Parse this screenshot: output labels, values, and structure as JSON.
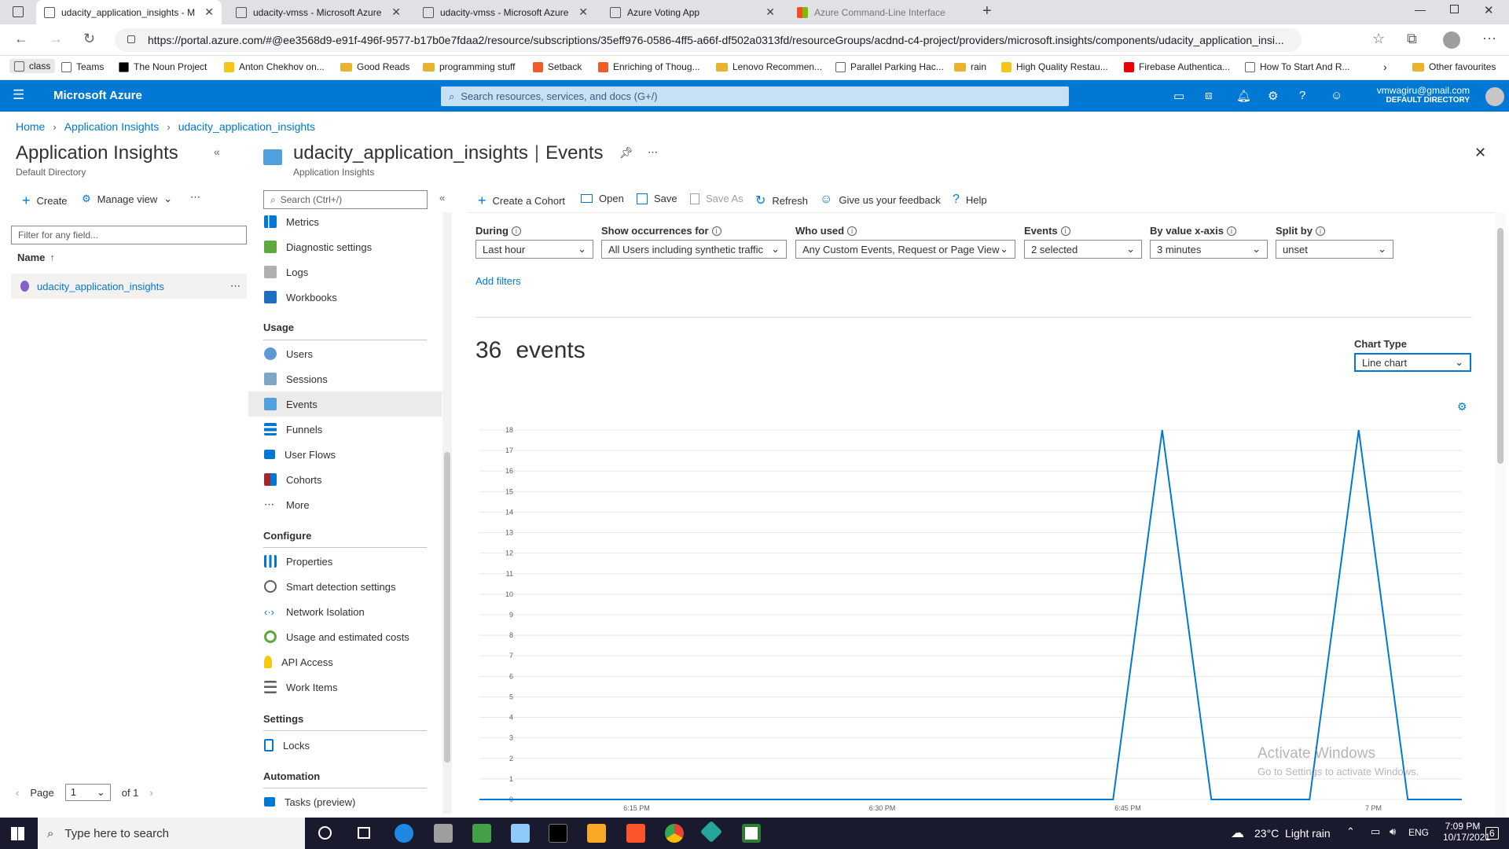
{
  "browser": {
    "tabs": [
      {
        "label": "udacity_application_insights - M",
        "active": true
      },
      {
        "label": "udacity-vmss - Microsoft Azure"
      },
      {
        "label": "udacity-vmss - Microsoft Azure"
      },
      {
        "label": "Azure Voting App"
      },
      {
        "label": "Azure Command-Line Interface"
      }
    ],
    "url": "https://portal.azure.com/#@ee3568d9-e91f-496f-9577-b17b0e7fdaa2/resource/subscriptions/35eff976-0586-4ff5-a66f-df502a0313fd/resourceGroups/acdnd-c4-project/providers/microsoft.insights/components/udacity_application_insi...",
    "bookmarks": [
      "class",
      "Teams",
      "The Noun Project",
      "Anton Chekhov on...",
      "Good Reads",
      "programming stuff",
      "Setback",
      "Enriching of Thoug...",
      "Lenovo Recommen...",
      "Parallel Parking Hac...",
      "rain",
      "High Quality Restau...",
      "Firebase Authentica...",
      "How To Start And R..."
    ],
    "other_favourites": "Other favourites"
  },
  "azure": {
    "brand": "Microsoft Azure",
    "search_placeholder": "Search resources, services, and docs (G+/)",
    "user_email": "vmwagiru@gmail.com",
    "user_directory": "DEFAULT DIRECTORY"
  },
  "breadcrumb": [
    "Home",
    "Application Insights",
    "udacity_application_insights"
  ],
  "left_blade": {
    "title": "Application Insights",
    "subtitle": "Default Directory",
    "create": "Create",
    "manage_view": "Manage view",
    "filter_placeholder": "Filter for any field...",
    "name_col": "Name",
    "item": "udacity_application_insights",
    "page_label": "Page",
    "page_value": "1",
    "page_of": "of 1"
  },
  "resource": {
    "title": "udacity_application_insights",
    "page": "Events",
    "subtitle": "Application Insights",
    "search_placeholder": "Search (Ctrl+/)"
  },
  "menu": {
    "top": [
      {
        "label": "Metrics",
        "icon": "metrics-icon"
      },
      {
        "label": "Diagnostic settings",
        "icon": "diagnostic-icon"
      },
      {
        "label": "Logs",
        "icon": "logs-icon"
      },
      {
        "label": "Workbooks",
        "icon": "workbooks-icon"
      }
    ],
    "usage_header": "Usage",
    "usage": [
      {
        "label": "Users"
      },
      {
        "label": "Sessions"
      },
      {
        "label": "Events",
        "selected": true
      },
      {
        "label": "Funnels"
      },
      {
        "label": "User Flows"
      },
      {
        "label": "Cohorts"
      },
      {
        "label": "More"
      }
    ],
    "configure_header": "Configure",
    "configure": [
      {
        "label": "Properties"
      },
      {
        "label": "Smart detection settings"
      },
      {
        "label": "Network Isolation"
      },
      {
        "label": "Usage and estimated costs"
      },
      {
        "label": "API Access"
      },
      {
        "label": "Work Items"
      }
    ],
    "settings_header": "Settings",
    "settings": [
      {
        "label": "Locks"
      }
    ],
    "automation_header": "Automation",
    "automation": [
      {
        "label": "Tasks (preview)"
      }
    ]
  },
  "toolbar": {
    "create_cohort": "Create a Cohort",
    "open": "Open",
    "save": "Save",
    "save_as": "Save As",
    "refresh": "Refresh",
    "feedback": "Give us your feedback",
    "help": "Help"
  },
  "filters": {
    "during": {
      "label": "During",
      "value": "Last hour"
    },
    "show_occurrences": {
      "label": "Show occurrences for",
      "value": "All Users including synthetic traffic"
    },
    "who_used": {
      "label": "Who used",
      "value": "Any Custom Events, Request or Page View"
    },
    "events": {
      "label": "Events",
      "value": "2 selected"
    },
    "by_value": {
      "label": "By value x-axis",
      "value": "3 minutes"
    },
    "split_by": {
      "label": "Split by",
      "value": "unset"
    },
    "add_filters": "Add filters"
  },
  "summary": {
    "count": "36",
    "unit": "events",
    "chart_type_label": "Chart Type",
    "chart_type_value": "Line chart"
  },
  "watermark": {
    "line1": "Activate Windows",
    "line2": "Go to Settings to activate Windows."
  },
  "chart_data": {
    "type": "line",
    "y_ticks": [
      0,
      1,
      2,
      3,
      4,
      5,
      6,
      7,
      8,
      9,
      10,
      11,
      12,
      13,
      14,
      15,
      16,
      17,
      18
    ],
    "ylim": [
      0,
      18
    ],
    "x_ticks": [
      "6:15 PM",
      "6:30 PM",
      "6:45 PM",
      "7 PM"
    ],
    "series": [
      {
        "color": "#0078d4",
        "points": [
          [
            0,
            0
          ],
          [
            0.645,
            0
          ],
          [
            0.695,
            18
          ],
          [
            0.745,
            0
          ],
          [
            0.845,
            0
          ],
          [
            0.895,
            18
          ],
          [
            0.945,
            0
          ],
          [
            1,
            0
          ]
        ]
      }
    ]
  },
  "taskbar": {
    "search_placeholder": "Type here to search",
    "weather": "23°C  Light rain",
    "lang": "ENG",
    "time": "7:09 PM",
    "date": "10/17/2021",
    "notif": "6"
  }
}
